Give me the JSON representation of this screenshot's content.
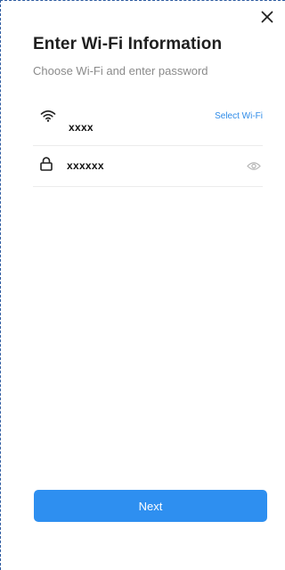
{
  "header": {
    "title": "Enter Wi-Fi Information",
    "subtitle": "Choose Wi-Fi and enter password",
    "close_icon": "close-icon"
  },
  "wifi": {
    "icon": "wifi-icon",
    "ssid_value": "xxxx",
    "select_label": "Select Wi-Fi"
  },
  "password": {
    "icon": "lock-icon",
    "value": "xxxxxx",
    "toggle_icon": "eye-icon"
  },
  "footer": {
    "next_label": "Next"
  },
  "colors": {
    "accent": "#2e8ff0",
    "link": "#2e8be8",
    "frame": "#2c5aa0"
  }
}
